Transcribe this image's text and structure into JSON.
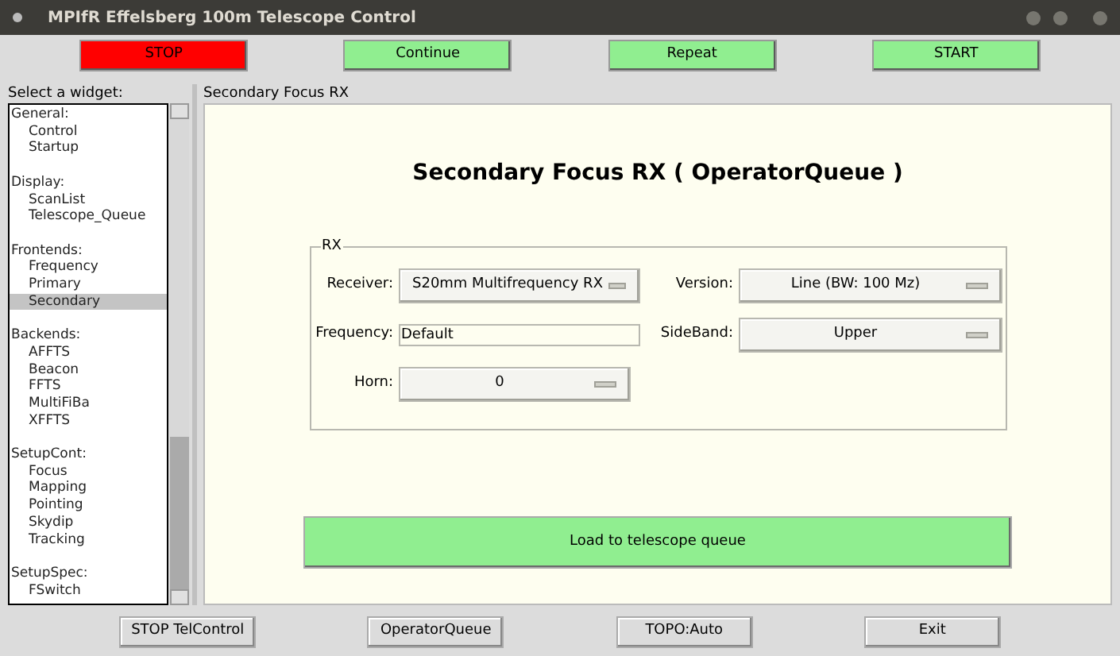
{
  "window": {
    "title": "MPIfR Effelsberg 100m Telescope Control"
  },
  "top_buttons": [
    {
      "label": "STOP",
      "kind": "stop"
    },
    {
      "label": "Continue",
      "kind": "go"
    },
    {
      "label": "Repeat",
      "kind": "go"
    },
    {
      "label": "START",
      "kind": "go"
    }
  ],
  "sidebar": {
    "label": "Select a widget:",
    "groups": [
      {
        "title": "General:",
        "items": [
          {
            "label": "Control",
            "selected": false
          },
          {
            "label": "Startup",
            "selected": false
          }
        ]
      },
      {
        "title": "Display:",
        "items": [
          {
            "label": "ScanList",
            "selected": false
          },
          {
            "label": "Telescope_Queue",
            "selected": false
          }
        ]
      },
      {
        "title": "Frontends:",
        "items": [
          {
            "label": "Frequency",
            "selected": false
          },
          {
            "label": "Primary",
            "selected": false
          },
          {
            "label": "Secondary",
            "selected": true
          }
        ]
      },
      {
        "title": "Backends:",
        "items": [
          {
            "label": "AFFTS",
            "selected": false
          },
          {
            "label": "Beacon",
            "selected": false
          },
          {
            "label": "FFTS",
            "selected": false
          },
          {
            "label": "MultiFiBa",
            "selected": false
          },
          {
            "label": "XFFTS",
            "selected": false
          }
        ]
      },
      {
        "title": "SetupCont:",
        "items": [
          {
            "label": "Focus",
            "selected": false
          },
          {
            "label": "Mapping",
            "selected": false
          },
          {
            "label": "Pointing",
            "selected": false
          },
          {
            "label": "Skydip",
            "selected": false
          },
          {
            "label": "Tracking",
            "selected": false
          }
        ]
      },
      {
        "title": "SetupSpec:",
        "items": [
          {
            "label": "FSwitch",
            "selected": false
          }
        ]
      }
    ]
  },
  "panel": {
    "label": "Secondary Focus RX",
    "heading": "Secondary Focus RX ( OperatorQueue )",
    "group": {
      "title": "RX",
      "receiver": {
        "label": "Receiver:",
        "value": "S20mm Multifrequency RX"
      },
      "version": {
        "label": "Version:",
        "value": "Line (BW: 100 Mz)"
      },
      "frequency": {
        "label": "Frequency:",
        "value": "Default"
      },
      "sideband": {
        "label": "SideBand:",
        "value": "Upper"
      },
      "horn": {
        "label": "Horn:",
        "value": "0"
      }
    },
    "load_button": "Load to telescope queue"
  },
  "bottom_buttons": [
    "STOP TelControl",
    "OperatorQueue",
    "TOPO:Auto",
    "Exit"
  ]
}
